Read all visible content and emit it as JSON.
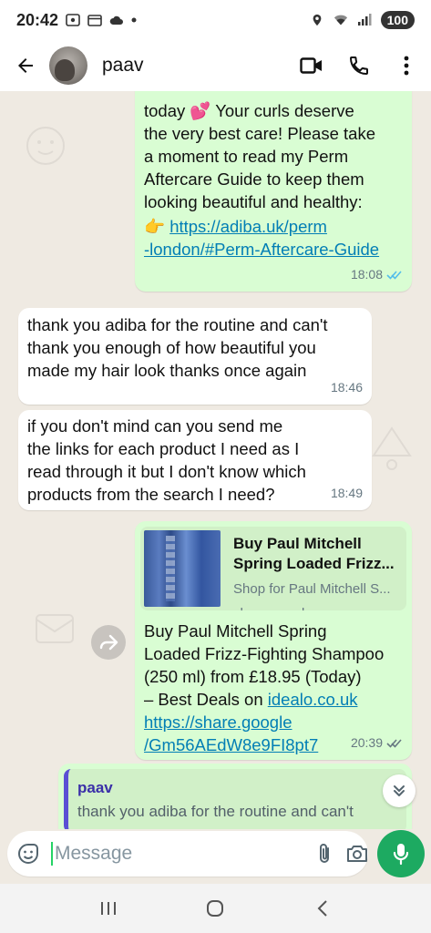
{
  "status_bar": {
    "time": "20:42",
    "battery": "100"
  },
  "header": {
    "contact_name": "paav"
  },
  "messages": [
    {
      "direction": "out",
      "text": "today 💕 Your curls deserve\nthe very best care! Please take\na moment to read my Perm\nAftercare Guide to keep them\nlooking beautiful and healthy:",
      "link_prefix": "👉 ",
      "link_line1": "https://adiba.uk/perm",
      "link_line2": "-london/#Perm-Aftercare-Guide",
      "time": "18:08"
    },
    {
      "direction": "in",
      "text": "thank you adiba for the routine and can't\nthank you enough of how beautiful you\nmade my hair look thanks once again",
      "time": "18:46"
    },
    {
      "direction": "in",
      "text": "if you don't mind can you send me\nthe links for each product I need as I\nread through it but I don't know which\nproducts from the search I need?",
      "time": "18:49"
    },
    {
      "direction": "out",
      "preview": {
        "title": "Buy Paul Mitchell\nSpring Loaded Frizz...",
        "description": "Shop for Paul Mitchell S...",
        "domain": "share.google"
      },
      "text": "Buy Paul Mitchell Spring\nLoaded Frizz-Fighting Shampoo\n(250 ml) from £18.95 (Today)\n– Best Deals on ",
      "inline_link": "idealo.co.uk",
      "link_line1": "https://share.google",
      "link_line2": "/Gm56AEdW8e9FI8pt7",
      "time": "20:39"
    },
    {
      "direction": "out",
      "quote": {
        "author": "paav",
        "text": "thank you adiba for the routine and can't"
      }
    }
  ],
  "composer": {
    "placeholder": "Message"
  },
  "colors": {
    "outgoing_bubble": "#d9fdd3",
    "incoming_bubble": "#ffffff",
    "link": "#027eb5",
    "mic_button": "#1daa61",
    "read_ticks": "#53bdeb",
    "chat_background": "#efeae2"
  },
  "icons": {
    "back": "arrow-left-icon",
    "video": "video-call-icon",
    "phone": "phone-icon",
    "menu": "more-vertical-icon",
    "forward": "forward-icon",
    "scroll_down": "double-chevron-down-icon",
    "sticker": "sticker-icon",
    "attach": "paperclip-icon",
    "camera": "camera-icon",
    "mic": "microphone-icon"
  }
}
